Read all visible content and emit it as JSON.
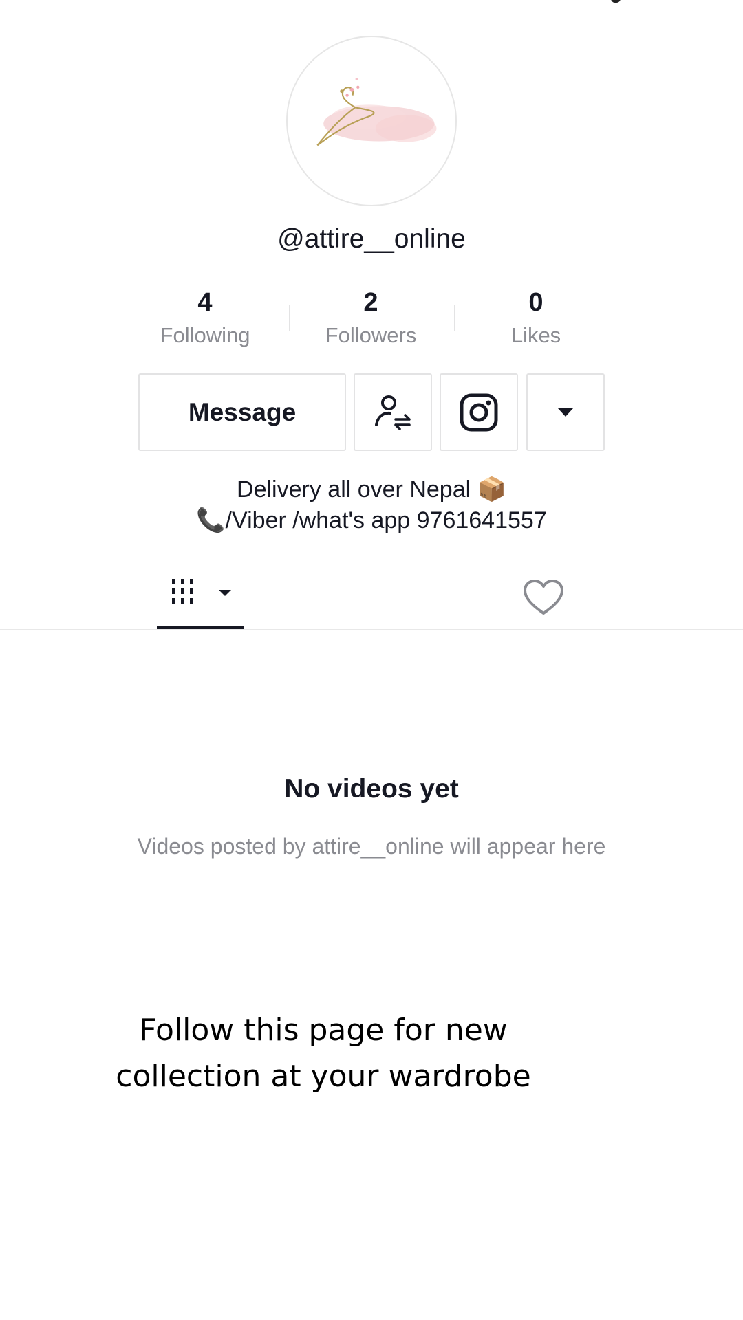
{
  "profile": {
    "username": "@attire__online",
    "avatar_icon": "hanger-logo-icon"
  },
  "stats": [
    {
      "value": "4",
      "label": "Following"
    },
    {
      "value": "2",
      "label": "Followers"
    },
    {
      "value": "0",
      "label": "Likes"
    }
  ],
  "actions": {
    "message_label": "Message",
    "follow_icon": "user-swap-icon",
    "instagram_icon": "instagram-icon",
    "more_icon": "caret-down-icon"
  },
  "bio": {
    "line1": "Delivery all over Nepal",
    "line1_emoji": "📦",
    "line2_emoji": "📞",
    "line2": "/Viber /what's app 9761641557"
  },
  "tabs": {
    "videos_icon": "grid-videos-icon",
    "liked_icon": "heart-outline-icon"
  },
  "empty_state": {
    "title": "No videos yet",
    "subtitle": "Videos posted by attire__online will appear here"
  },
  "overlay": {
    "line1": "Follow this page for new",
    "line2": "collection at your wardrobe"
  },
  "colors": {
    "text_primary": "#161823",
    "text_secondary": "#8a8b91",
    "border": "#e3e3e4"
  }
}
